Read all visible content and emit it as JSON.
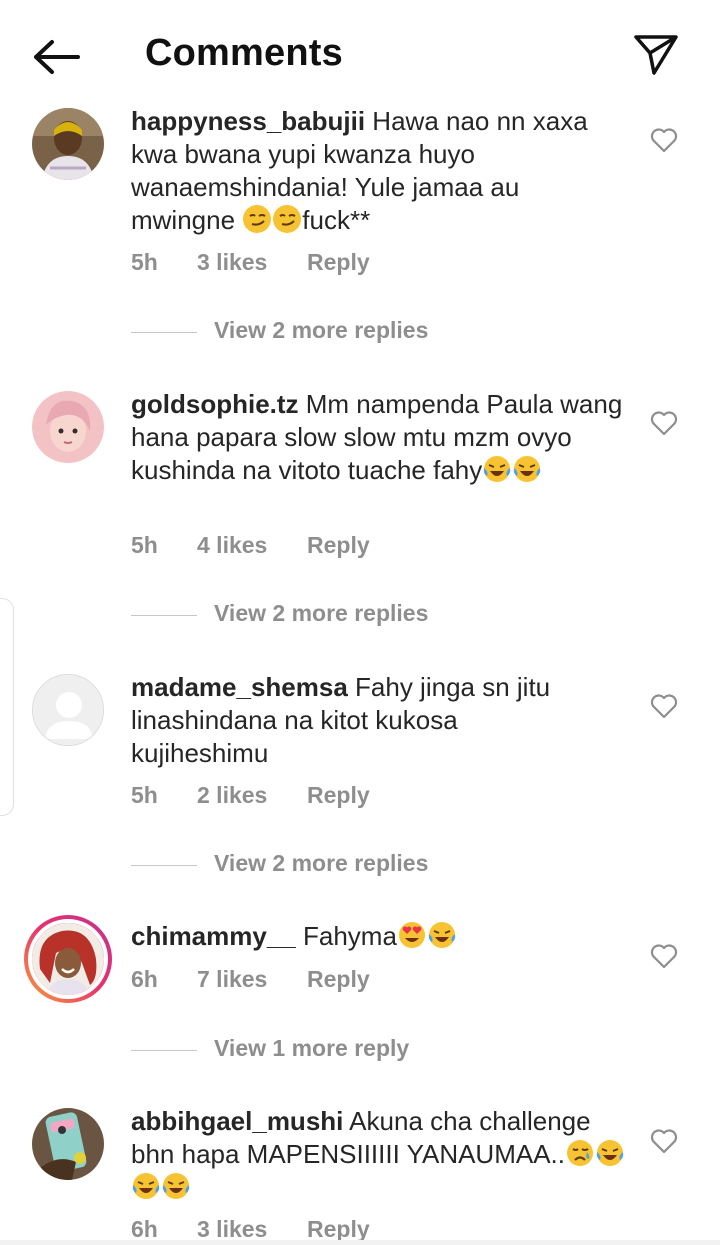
{
  "header": {
    "title": "Comments",
    "back_icon": "arrow-left-icon",
    "send_icon": "paper-plane-icon"
  },
  "comments": [
    {
      "username": "happyness_babujii",
      "text_parts": [
        " Hawa nao nn xaxa kwa bwana yupi kwanza huyo wanaemshindania! Yule jamaa au mwingne ",
        "fuck**"
      ],
      "time": "5h",
      "likes": "3 likes",
      "reply": "Reply",
      "view_replies": "View 2 more replies"
    },
    {
      "username": "goldsophie.tz",
      "text_parts": [
        " Mm nampenda Paula wang hana papara slow slow mtu mzm ovyo kushinda na vitoto tuache fahy"
      ],
      "time": "5h",
      "likes": "4 likes",
      "reply": "Reply",
      "view_replies": "View 2 more replies"
    },
    {
      "username": "madame_shemsa",
      "text_parts": [
        " Fahy jinga sn jitu linashindana na kitot kukosa kujiheshimu"
      ],
      "time": "5h",
      "likes": "2 likes",
      "reply": "Reply",
      "view_replies": "View 2 more replies"
    },
    {
      "username": "chimammy__",
      "text_parts": [
        " Fahyma"
      ],
      "time": "6h",
      "likes": "7 likes",
      "reply": "Reply",
      "view_replies": "View 1 more reply"
    },
    {
      "username": "abbihgael_mushi",
      "text_parts": [
        " Akuna cha challenge bhn hapa MAPENSIIIIII YANAUMAA.."
      ],
      "time": "6h",
      "likes": "3 likes",
      "reply": "Reply"
    }
  ],
  "colors": {
    "text": "#262626",
    "muted": "#8e8e8e",
    "story_ring_start": "#f9a13a",
    "story_ring_end": "#c2318f"
  }
}
